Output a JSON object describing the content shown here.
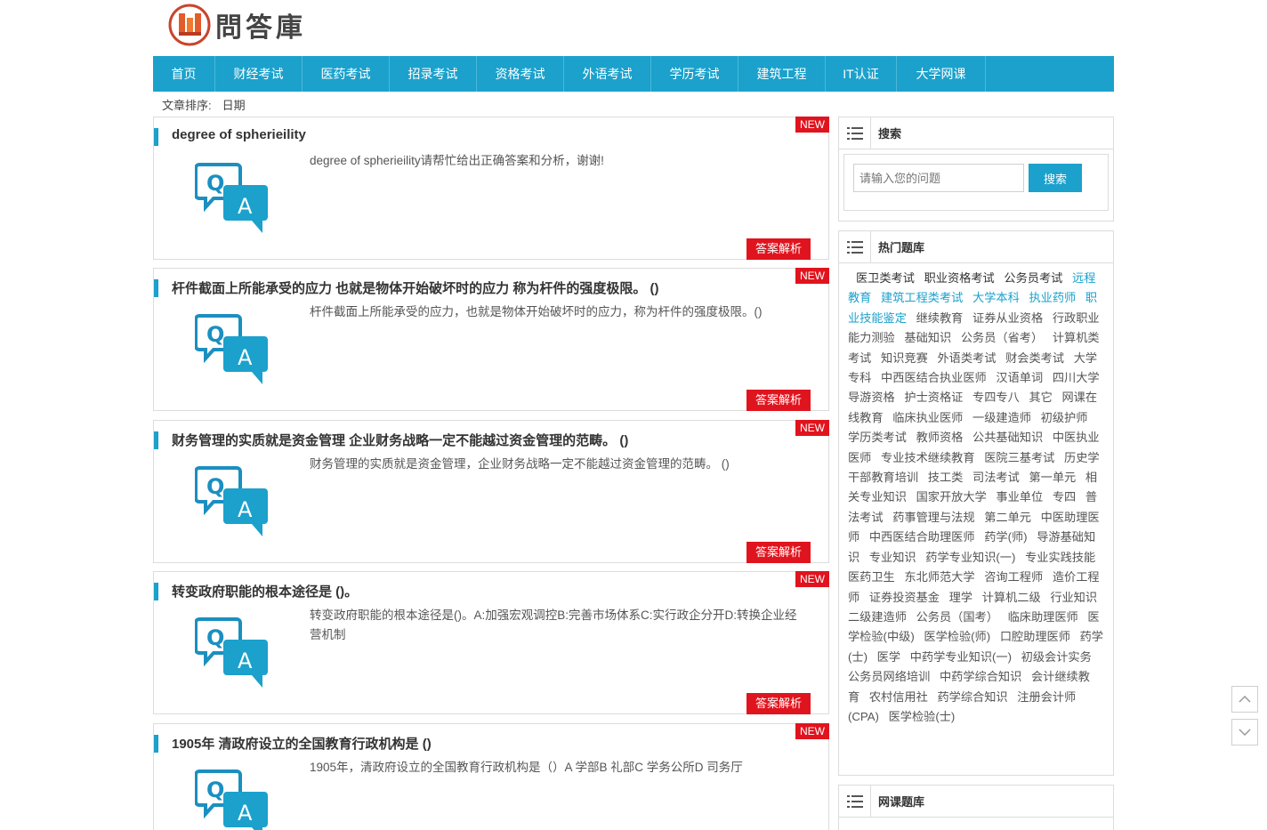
{
  "logo": {
    "text": "問答庫"
  },
  "nav": {
    "items": [
      {
        "label": "首页",
        "w": 70
      },
      {
        "label": "财经考试",
        "w": 98
      },
      {
        "label": "医药考试",
        "w": 98
      },
      {
        "label": "招录考试",
        "w": 98
      },
      {
        "label": "资格考试",
        "w": 98
      },
      {
        "label": "外语考试",
        "w": 98
      },
      {
        "label": "学历考试",
        "w": 98
      },
      {
        "label": "建筑工程",
        "w": 98
      },
      {
        "label": "IT认证",
        "w": 80
      },
      {
        "label": "大学网课",
        "w": 100
      }
    ]
  },
  "sort": {
    "label": "文章排序:",
    "option": "日期"
  },
  "questions": [
    {
      "title": "degree of spherieility",
      "desc": "degree of spherieility请帮忙给出正确答案和分析，谢谢!",
      "badge": "NEW",
      "button": "答案解析"
    },
    {
      "title": "杆件截面上所能承受的应力 也就是物体开始破坏时的应力 称为杆件的强度极限。 ()",
      "desc": "杆件截面上所能承受的应力，也就是物体开始破坏时的应力，称为杆件的强度极限。()",
      "badge": "NEW",
      "button": "答案解析"
    },
    {
      "title": "财务管理的实质就是资金管理 企业财务战略一定不能越过资金管理的范畴。 ()",
      "desc": "财务管理的实质就是资金管理，企业财务战略一定不能越过资金管理的范畴。 ()",
      "badge": "NEW",
      "button": "答案解析"
    },
    {
      "title": "转变政府职能的根本途径是 ()。",
      "desc": "转变政府职能的根本途径是()。A:加强宏观调控B:完善市场体系C:实行政企分开D:转换企业经营机制",
      "badge": "NEW",
      "button": "答案解析"
    },
    {
      "title": "1905年 清政府设立的全国教育行政机构是 ()",
      "desc": "1905年，清政府设立的全国教育行政机构是（）A 学部B 礼部C 学务公所D 司务厅",
      "badge": "NEW",
      "button": "答案解析"
    }
  ],
  "search": {
    "title": "搜索",
    "placeholder": "请输入您的问题",
    "button": "搜索"
  },
  "hot": {
    "title": "热门题库",
    "tags": [
      {
        "t": "医卫类考试",
        "c": "dark"
      },
      {
        "t": "职业资格考试",
        "c": "dark"
      },
      {
        "t": "公务员考试",
        "c": "dark"
      },
      {
        "t": "远程教育",
        "c": "blue"
      },
      {
        "t": "建筑工程类考试",
        "c": "blue"
      },
      {
        "t": "大学本科",
        "c": "blue"
      },
      {
        "t": "执业药师",
        "c": "blue"
      },
      {
        "t": "职业技能鉴定",
        "c": "blue"
      },
      {
        "t": "继续教育",
        "c": ""
      },
      {
        "t": "证券从业资格",
        "c": ""
      },
      {
        "t": "行政职业能力测验",
        "c": ""
      },
      {
        "t": "基础知识",
        "c": ""
      },
      {
        "t": "公务员（省考）",
        "c": ""
      },
      {
        "t": "计算机类考试",
        "c": ""
      },
      {
        "t": "知识竞赛",
        "c": ""
      },
      {
        "t": "外语类考试",
        "c": ""
      },
      {
        "t": "财会类考试",
        "c": ""
      },
      {
        "t": "大学专科",
        "c": ""
      },
      {
        "t": "中西医结合执业医师",
        "c": ""
      },
      {
        "t": "汉语单词",
        "c": ""
      },
      {
        "t": "四川大学",
        "c": ""
      },
      {
        "t": "导游资格",
        "c": ""
      },
      {
        "t": "护士资格证",
        "c": ""
      },
      {
        "t": "专四专八",
        "c": ""
      },
      {
        "t": "其它",
        "c": ""
      },
      {
        "t": "网课在线教育",
        "c": ""
      },
      {
        "t": "临床执业医师",
        "c": ""
      },
      {
        "t": "一级建造师",
        "c": ""
      },
      {
        "t": "初级护师",
        "c": ""
      },
      {
        "t": "学历类考试",
        "c": ""
      },
      {
        "t": "教师资格",
        "c": ""
      },
      {
        "t": "公共基础知识",
        "c": ""
      },
      {
        "t": "中医执业医师",
        "c": ""
      },
      {
        "t": "专业技术继续教育",
        "c": ""
      },
      {
        "t": "医院三基考试",
        "c": ""
      },
      {
        "t": "历史学",
        "c": ""
      },
      {
        "t": "干部教育培训",
        "c": ""
      },
      {
        "t": "技工类",
        "c": ""
      },
      {
        "t": "司法考试",
        "c": ""
      },
      {
        "t": "第一单元",
        "c": ""
      },
      {
        "t": "相关专业知识",
        "c": ""
      },
      {
        "t": "国家开放大学",
        "c": ""
      },
      {
        "t": "事业单位",
        "c": ""
      },
      {
        "t": "专四",
        "c": ""
      },
      {
        "t": "普法考试",
        "c": ""
      },
      {
        "t": "药事管理与法规",
        "c": ""
      },
      {
        "t": "第二单元",
        "c": ""
      },
      {
        "t": "中医助理医师",
        "c": ""
      },
      {
        "t": "中西医结合助理医师",
        "c": ""
      },
      {
        "t": "药学(师)",
        "c": ""
      },
      {
        "t": "导游基础知识",
        "c": ""
      },
      {
        "t": "专业知识",
        "c": ""
      },
      {
        "t": "药学专业知识(一)",
        "c": ""
      },
      {
        "t": "专业实践技能",
        "c": ""
      },
      {
        "t": "医药卫生",
        "c": ""
      },
      {
        "t": "东北师范大学",
        "c": ""
      },
      {
        "t": "咨询工程师",
        "c": ""
      },
      {
        "t": "造价工程师",
        "c": ""
      },
      {
        "t": "证券投资基金",
        "c": ""
      },
      {
        "t": "理学",
        "c": ""
      },
      {
        "t": "计算机二级",
        "c": ""
      },
      {
        "t": "行业知识",
        "c": ""
      },
      {
        "t": "二级建造师",
        "c": ""
      },
      {
        "t": "公务员（国考）",
        "c": ""
      },
      {
        "t": "临床助理医师",
        "c": ""
      },
      {
        "t": "医学检验(中级)",
        "c": ""
      },
      {
        "t": "医学检验(师)",
        "c": ""
      },
      {
        "t": "口腔助理医师",
        "c": ""
      },
      {
        "t": "药学(士)",
        "c": ""
      },
      {
        "t": "医学",
        "c": ""
      },
      {
        "t": "中药学专业知识(一)",
        "c": ""
      },
      {
        "t": "初级会计实务",
        "c": ""
      },
      {
        "t": "公务员网络培训",
        "c": ""
      },
      {
        "t": "中药学综合知识",
        "c": ""
      },
      {
        "t": "会计继续教育",
        "c": ""
      },
      {
        "t": "农村信用社",
        "c": ""
      },
      {
        "t": "药学综合知识",
        "c": ""
      },
      {
        "t": "注册会计师(CPA)",
        "c": ""
      },
      {
        "t": "医学检验(士)",
        "c": ""
      }
    ]
  },
  "online": {
    "title": "网课题库"
  }
}
